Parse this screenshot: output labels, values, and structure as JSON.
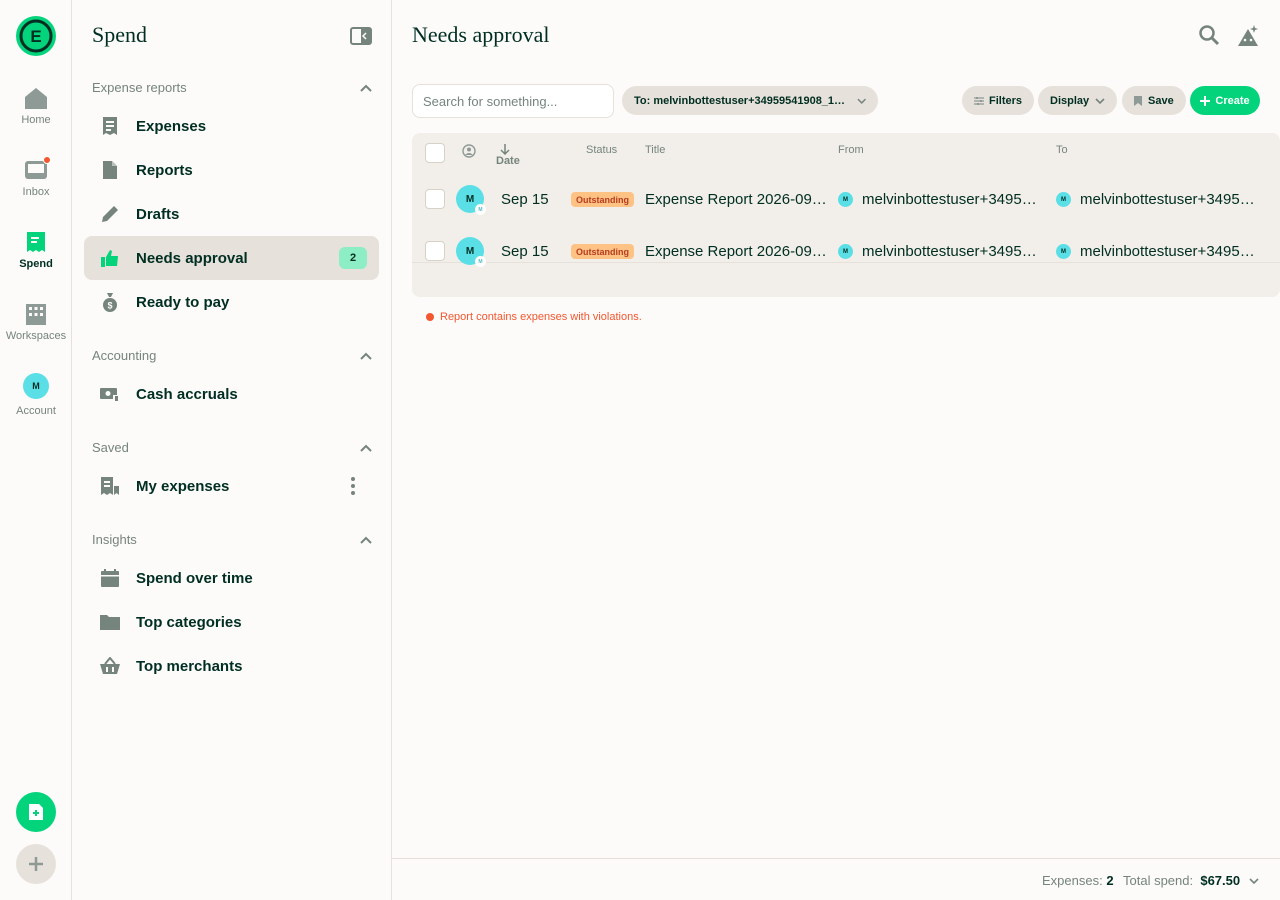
{
  "rail": {
    "logo_letter": "E",
    "items": [
      {
        "label": "Home",
        "icon": "home-icon"
      },
      {
        "label": "Inbox",
        "icon": "inbox-icon"
      },
      {
        "label": "Spend",
        "icon": "receipt-icon"
      },
      {
        "label": "Workspaces",
        "icon": "building-icon"
      },
      {
        "label": "Account",
        "icon": "avatar",
        "avatar_initial": "M"
      }
    ]
  },
  "sidebar": {
    "title": "Spend",
    "sections": [
      {
        "heading": "Expense reports",
        "items": [
          {
            "label": "Expenses",
            "icon": "receipt-icon"
          },
          {
            "label": "Reports",
            "icon": "document-icon"
          },
          {
            "label": "Drafts",
            "icon": "pencil-icon"
          },
          {
            "label": "Needs approval",
            "icon": "thumbs-up-icon",
            "badge": "2",
            "active": true
          },
          {
            "label": "Ready to pay",
            "icon": "money-bag-icon"
          }
        ]
      },
      {
        "heading": "Accounting",
        "items": [
          {
            "label": "Cash accruals",
            "icon": "cash-icon"
          }
        ]
      },
      {
        "heading": "Saved",
        "items": [
          {
            "label": "My expenses",
            "icon": "receipt-bookmark-icon"
          }
        ]
      },
      {
        "heading": "Insights",
        "items": [
          {
            "label": "Spend over time",
            "icon": "calendar-icon"
          },
          {
            "label": "Top categories",
            "icon": "folder-icon"
          },
          {
            "label": "Top merchants",
            "icon": "basket-icon"
          }
        ]
      }
    ]
  },
  "main": {
    "title": "Needs approval",
    "search_placeholder": "Search for something...",
    "filter_pill": "To: melvinbottestuser+34959541908_1_we...",
    "buttons": {
      "filters": "Filters",
      "display": "Display",
      "save": "Save",
      "create": "Create"
    },
    "columns": {
      "date": "Date",
      "status": "Status",
      "title": "Title",
      "from": "From",
      "to": "To"
    },
    "rows": [
      {
        "avatar": "M",
        "date": "Sep 15",
        "status": "Outstanding",
        "title": "Expense Report 2026-09-...",
        "from": "melvinbottestuser+34959...",
        "to": "melvinbottestuser+34959..."
      },
      {
        "avatar": "M",
        "date": "Sep 15",
        "status": "Outstanding",
        "title": "Expense Report 2026-09-...",
        "from": "melvinbottestuser+34959...",
        "to": "melvinbottestuser+34959..."
      }
    ],
    "violation_text": "Report contains expenses with violations."
  },
  "footer": {
    "expenses_label": "Expenses:",
    "expenses_count": "2",
    "total_label": "Total spend:",
    "total_value": "$67.50"
  },
  "colors": {
    "accent": "#03d47c",
    "badge": "#8dedc4",
    "status_bg": "#ffc285",
    "violation": "#f25730"
  }
}
